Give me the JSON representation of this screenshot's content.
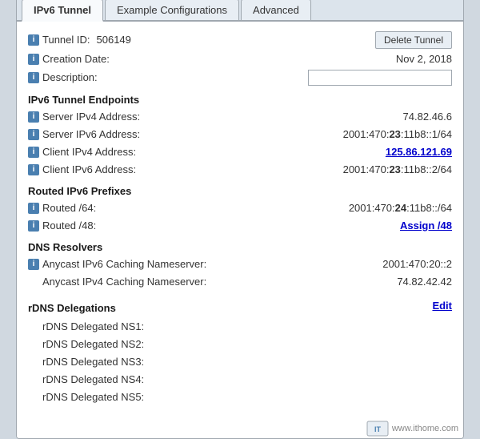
{
  "tabs": [
    {
      "label": "IPv6 Tunnel",
      "active": true
    },
    {
      "label": "Example Configurations",
      "active": false
    },
    {
      "label": "Advanced",
      "active": false
    }
  ],
  "tunnel": {
    "id_label": "Tunnel ID:",
    "id_value": "506149",
    "creation_date_label": "Creation Date:",
    "creation_date_value": "Nov 2, 2018",
    "description_label": "Description:",
    "description_value": "",
    "delete_btn": "Delete Tunnel"
  },
  "endpoints": {
    "header": "IPv6 Tunnel Endpoints",
    "server_ipv4_label": "Server IPv4 Address:",
    "server_ipv4_value": "74.82.46.6",
    "server_ipv6_label": "Server IPv6 Address:",
    "server_ipv6_value": "2001:470:",
    "server_ipv6_bold": "23",
    "server_ipv6_rest": ":11b8::1/64",
    "client_ipv4_label": "Client IPv4 Address:",
    "client_ipv4_value": "125.86.121.69",
    "client_ipv6_label": "Client IPv6 Address:",
    "client_ipv6_value": "2001:470:",
    "client_ipv6_bold": "23",
    "client_ipv6_rest": ":11b8::2/64"
  },
  "routed": {
    "header": "Routed IPv6 Prefixes",
    "r64_label": "Routed /64:",
    "r64_value": "2001:470:",
    "r64_bold": "24",
    "r64_rest": ":11b8::/64",
    "r48_label": "Routed /48:",
    "r48_value": "Assign /48"
  },
  "dns": {
    "header": "DNS Resolvers",
    "anycast_ipv6_label": "Anycast IPv6 Caching Nameserver:",
    "anycast_ipv6_value": "2001:470:20::2",
    "anycast_ipv4_label": "Anycast IPv4 Caching Nameserver:",
    "anycast_ipv4_value": "74.82.42.42"
  },
  "rdns": {
    "header": "rDNS Delegations",
    "edit_label": "Edit",
    "ns1_label": "rDNS Delegated NS1:",
    "ns1_value": "",
    "ns2_label": "rDNS Delegated NS2:",
    "ns2_value": "",
    "ns3_label": "rDNS Delegated NS3:",
    "ns3_value": "",
    "ns4_label": "rDNS Delegated NS4:",
    "ns4_value": "",
    "ns5_label": "rDNS Delegated NS5:",
    "ns5_value": ""
  },
  "watermark": "www.ithome.com"
}
